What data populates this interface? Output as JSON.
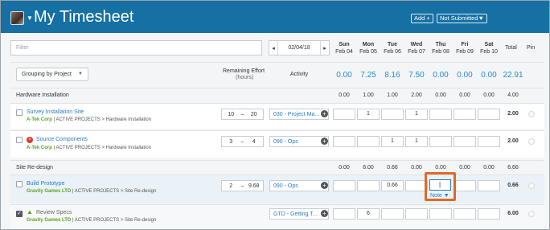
{
  "header": {
    "title": "My Timesheet",
    "add_label": "Add +",
    "status_label": "Not Submitted▼",
    "bg_color": "#1670a3"
  },
  "filter": {
    "placeholder": "Filter"
  },
  "date": {
    "value": "02/04/18",
    "prev": "◂",
    "next": "▸"
  },
  "days": [
    {
      "name": "Sun",
      "date": "Feb 04",
      "total": "0.00"
    },
    {
      "name": "Mon",
      "date": "Feb 05",
      "total": "7.25"
    },
    {
      "name": "Tue",
      "date": "Feb 06",
      "total": "8.16"
    },
    {
      "name": "Wed",
      "date": "Feb 07",
      "total": "7.50"
    },
    {
      "name": "Thu",
      "date": "Feb 08",
      "total": "0.00"
    },
    {
      "name": "Fri",
      "date": "Feb 09",
      "total": "0.00"
    },
    {
      "name": "Sat",
      "date": "Feb 10",
      "total": "0.00"
    }
  ],
  "columns": {
    "total": "Total",
    "pin": "Pin",
    "remaining_effort": "Remaining Effort",
    "hours": "(hours)",
    "activity": "Activity",
    "grand_total": "22.91"
  },
  "grouping": {
    "label": "Grouping by Project"
  },
  "sections": [
    {
      "label": "Hardware Installation",
      "totals": [
        "0.00",
        "1.00",
        "1.00",
        "2.00",
        "0.00",
        "0.00",
        "0.00"
      ],
      "total": "4.00"
    },
    {
      "label": "Site Re-design",
      "totals": [
        "0.00",
        "6.00",
        "0.66",
        "0.00",
        "0.00",
        "0.00",
        "0.00"
      ],
      "total": "6.66"
    }
  ],
  "tasks": [
    {
      "name": "Survey Installation Site",
      "company": "A-Tek Corp",
      "path": " | ACTIVE PROJECTS > Hardware Installation",
      "effort_min": "10",
      "effort_max": "20",
      "activity": "030 - Project Ma...",
      "cells": [
        "",
        "1",
        "",
        "1",
        "",
        "",
        ""
      ],
      "total": "2.00"
    },
    {
      "name": "Source Components",
      "company": "A-Tek Corp",
      "path": " | ACTIVE PROJECTS > Hardware Installation",
      "effort_min": "3",
      "effort_max": "4",
      "activity": "090 - Ops",
      "cells": [
        "",
        "",
        "1",
        "1",
        "",
        "",
        ""
      ],
      "total": "2.00"
    },
    {
      "name": "Build Prototype",
      "company": "Gravity Games LTD",
      "path": " | ACTIVE PROJECTS > Site Re-design",
      "effort_min": "2",
      "effort_max": "9.68",
      "activity": "090 - Ops",
      "cells": [
        "",
        "",
        "0.66",
        "",
        "|",
        "",
        ""
      ],
      "total": "0.66",
      "note": "Note ▼"
    },
    {
      "name": "Review Specs",
      "company": "Gravity Games LTD",
      "path": " | ACTIVE PROJECTS > Site Re-design",
      "effort_min": "",
      "effort_max": "",
      "activity": "GTD - Getting T...",
      "cells": [
        "",
        "6",
        "",
        "",
        "",
        "",
        ""
      ],
      "total": "6.00"
    }
  ],
  "icons": {
    "warning": "error-circle-icon",
    "ok": "warning-triangle-icon",
    "add": "plus-circle-icon"
  }
}
